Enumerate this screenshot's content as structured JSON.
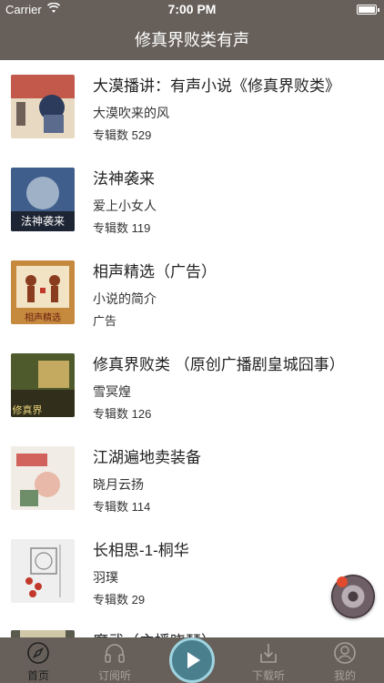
{
  "status_bar": {
    "carrier": "Carrier",
    "time": "7:00 PM"
  },
  "nav": {
    "title": "修真界败类有声"
  },
  "items": [
    {
      "title": "大漠播讲：有声小说《修真界败类》",
      "author": "大漠吹来的风",
      "count": "专辑数 529",
      "cover_colors": [
        "#b8382c",
        "#e8d9c2",
        "#2c3a5c"
      ]
    },
    {
      "title": "法神袭来",
      "author": "爱上小女人",
      "count": "专辑数 119",
      "cover_colors": [
        "#3f5e8c",
        "#c9d4e0",
        "#1d2433"
      ],
      "cover_text": "法神袭来"
    },
    {
      "title": "相声精选（广告）",
      "author": "小说的简介",
      "count": "广告",
      "cover_colors": [
        "#c58a3e",
        "#f1e3c4",
        "#8a3d1e"
      ],
      "cover_text": "相声精选"
    },
    {
      "title": "修真界败类 （原创广播剧皇城囧事）",
      "author": "雪冥煌",
      "count": "专辑数 126",
      "cover_colors": [
        "#4e5a2c",
        "#d9b86b",
        "#2a2318"
      ],
      "cover_text": "修真界"
    },
    {
      "title": "江湖遍地卖装备",
      "author": "晓月云扬",
      "count": "专辑数 114",
      "cover_colors": [
        "#f1ece5",
        "#c9413a",
        "#6e8e6a"
      ]
    },
    {
      "title": "长相思-1-桐华",
      "author": "羽璞",
      "count": "专辑数 29",
      "cover_colors": [
        "#efefef",
        "#c0392b",
        "#888888"
      ]
    },
    {
      "title": "魔武（主播晓琴）",
      "author": "",
      "count": "",
      "cover_colors": [
        "#5a5a4e",
        "#d0c7a8",
        "#2a2a22"
      ]
    }
  ],
  "tabs": [
    {
      "label": "首页",
      "icon": "compass-icon",
      "active": true
    },
    {
      "label": "订阅听",
      "icon": "headphones-icon",
      "active": false
    },
    {
      "label": "",
      "icon": "play-icon",
      "active": false
    },
    {
      "label": "下载听",
      "icon": "download-icon",
      "active": false
    },
    {
      "label": "我的",
      "icon": "profile-icon",
      "active": false
    }
  ]
}
